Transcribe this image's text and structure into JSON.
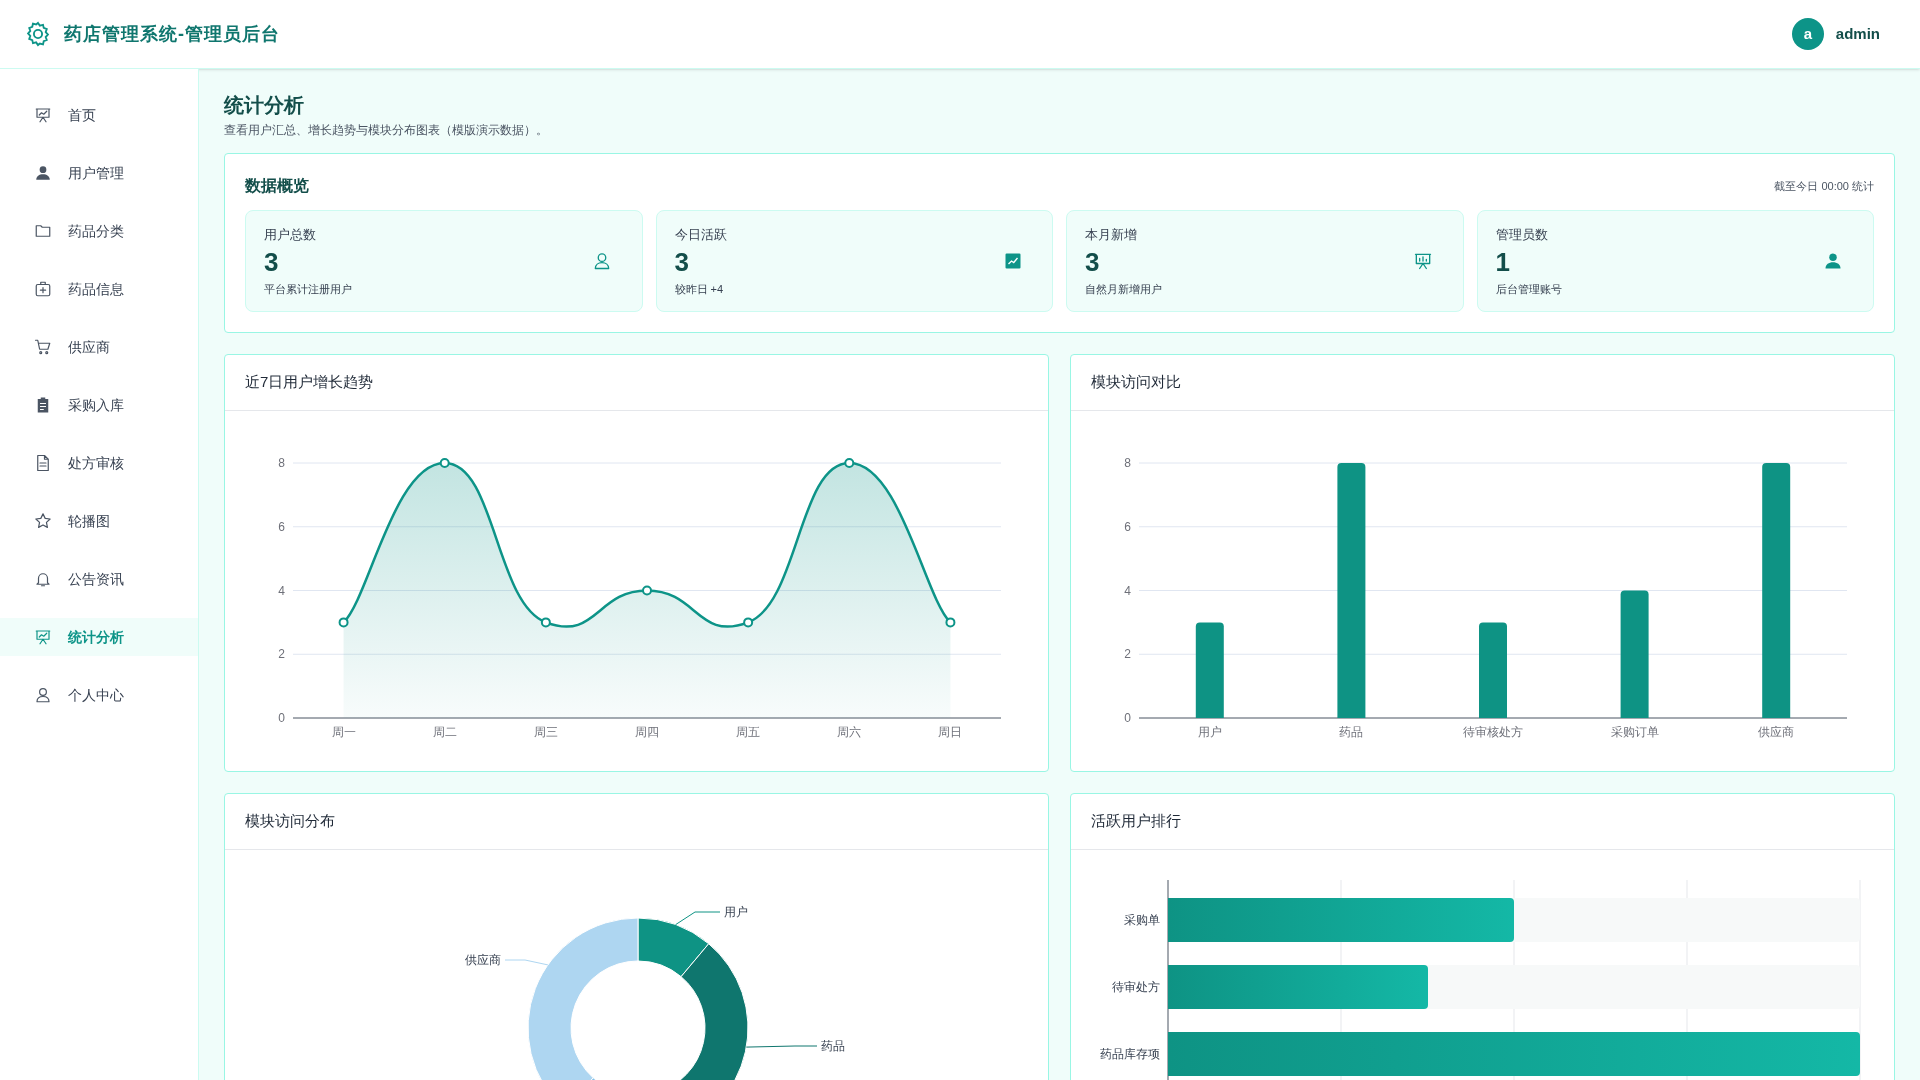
{
  "header": {
    "title": "药店管理系统-管理员后台",
    "user": {
      "avatar": "a",
      "name": "admin"
    }
  },
  "sidebar": {
    "items": [
      {
        "label": "首页",
        "selected": false
      },
      {
        "label": "用户管理",
        "selected": false
      },
      {
        "label": "药品分类",
        "selected": false
      },
      {
        "label": "药品信息",
        "selected": false
      },
      {
        "label": "供应商",
        "selected": false
      },
      {
        "label": "采购入库",
        "selected": false
      },
      {
        "label": "处方审核",
        "selected": false
      },
      {
        "label": "轮播图",
        "selected": false
      },
      {
        "label": "公告资讯",
        "selected": false
      },
      {
        "label": "统计分析",
        "selected": true
      },
      {
        "label": "个人中心",
        "selected": false
      }
    ]
  },
  "page": {
    "title": "统计分析",
    "subtitle": "查看用户汇总、增长趋势与模块分布图表（模版演示数据）。"
  },
  "overview": {
    "title": "数据概览",
    "note": "截至今日 00:00 统计",
    "stats": [
      {
        "label": "用户总数",
        "value": "3",
        "caption": "平台累计注册用户"
      },
      {
        "label": "今日活跃",
        "value": "3",
        "caption": "较昨日 +4"
      },
      {
        "label": "本月新增",
        "value": "3",
        "caption": "自然月新增用户"
      },
      {
        "label": "管理员数",
        "value": "1",
        "caption": "后台管理账号"
      }
    ]
  },
  "trend_chart": {
    "title": "近7日用户增长趋势",
    "chart_data": {
      "type": "area",
      "categories": [
        "周一",
        "周二",
        "周三",
        "周四",
        "周五",
        "周六",
        "周日"
      ],
      "series": [
        {
          "color": "#0d9488",
          "values": [
            3,
            8,
            3,
            4,
            3,
            8,
            3
          ]
        }
      ],
      "ylim": [
        0,
        8
      ],
      "yticks": [
        0,
        2,
        4,
        6,
        8
      ],
      "grid": true
    }
  },
  "module_chart": {
    "title": "模块访问对比",
    "chart_data": {
      "type": "bar",
      "categories": [
        "用户",
        "药品",
        "待审核处方",
        "采购订单",
        "供应商"
      ],
      "series": [
        {
          "color": "#0e9384",
          "values": [
            3,
            8,
            3,
            4,
            8
          ]
        }
      ],
      "ylim": [
        0,
        8
      ],
      "yticks": [
        0,
        2,
        4,
        6,
        8
      ],
      "grid": true
    }
  },
  "distribution": {
    "title": "模块访问分布",
    "labels": [
      "用户",
      "药品",
      "供应商"
    ]
  },
  "ranking": {
    "title": "活跃用户排行",
    "bars": [
      {
        "label": "采购单",
        "level": 0.5
      },
      {
        "label": "待审处方",
        "level": 0.375
      },
      {
        "label": "药品库存项",
        "level": 1
      }
    ]
  }
}
